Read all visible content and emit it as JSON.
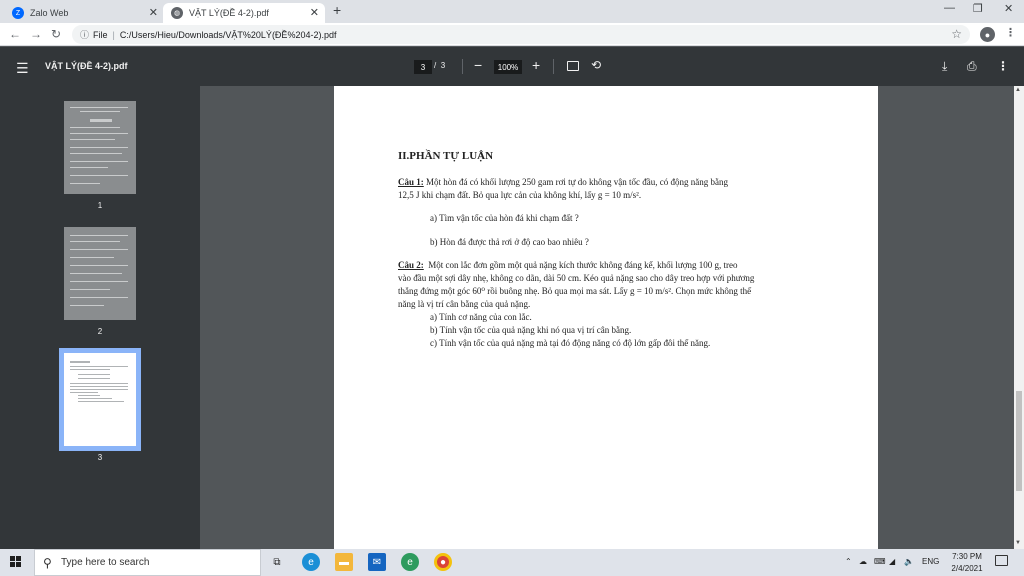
{
  "browser": {
    "tabs": [
      {
        "label": "Zalo Web",
        "active": false
      },
      {
        "label": "VẬT LÝ(ĐỀ 4-2).pdf",
        "active": true
      }
    ],
    "address_prefix": "File",
    "address": "C:/Users/Hieu/Downloads/VẬT%20LÝ(ĐỀ%204-2).pdf"
  },
  "pdf_toolbar": {
    "title": "VẬT LÝ(ĐỀ 4-2).pdf",
    "current_page": "3",
    "page_separator": "/",
    "total_pages": "3",
    "zoom": "100%"
  },
  "sidebar": {
    "thumbnails": [
      {
        "number": "1",
        "selected": false
      },
      {
        "number": "2",
        "selected": false
      },
      {
        "number": "3",
        "selected": true
      }
    ]
  },
  "document": {
    "heading": "II.PHẦN TỰ LUẬN",
    "q1_label": "Câu 1:",
    "q1_text_line1": "Một hòn đá có khối lượng 250 gam rơi tự do không vận tốc đầu, có động năng bằng",
    "q1_text_line2": "12,5 J khi chạm đất. Bỏ qua lực cản của không khí, lấy g = 10 m/s².",
    "q1_a": "a)  Tìm vận tốc của hòn đá khi chạm đất ?",
    "q1_b": "b)  Hòn đá được thả rơi ở độ cao bao nhiêu ?",
    "q2_label": "Câu 2:",
    "q2_text_line1": "Một con lắc đơn gồm một quả nặng kích thước không đáng kể, khối lượng 100 g, treo",
    "q2_text_line2": "vào đầu một sợi dây nhẹ, không co dãn, dài 50 cm. Kéo quả nặng sao cho dây treo hợp với phương",
    "q2_text_line3": "thẳng đứng một góc 60⁰ rồi buông nhẹ. Bỏ qua mọi ma sát. Lấy g = 10 m/s². Chọn mức không thế",
    "q2_text_line4": "năng là vị trí cân bằng của quả nặng.",
    "q2_a": "a)  Tính cơ năng của con lắc.",
    "q2_b": "b)  Tính vận tốc của quả nặng khi nó qua vị trí cân bằng.",
    "q2_c": "c)  Tính vận tốc của quả nặng mà tại đó động năng có độ lớn gấp đôi thế năng."
  },
  "taskbar": {
    "search_placeholder": "Type here to search",
    "lang": "ENG",
    "time": "7:30 PM",
    "date": "2/4/2021"
  }
}
